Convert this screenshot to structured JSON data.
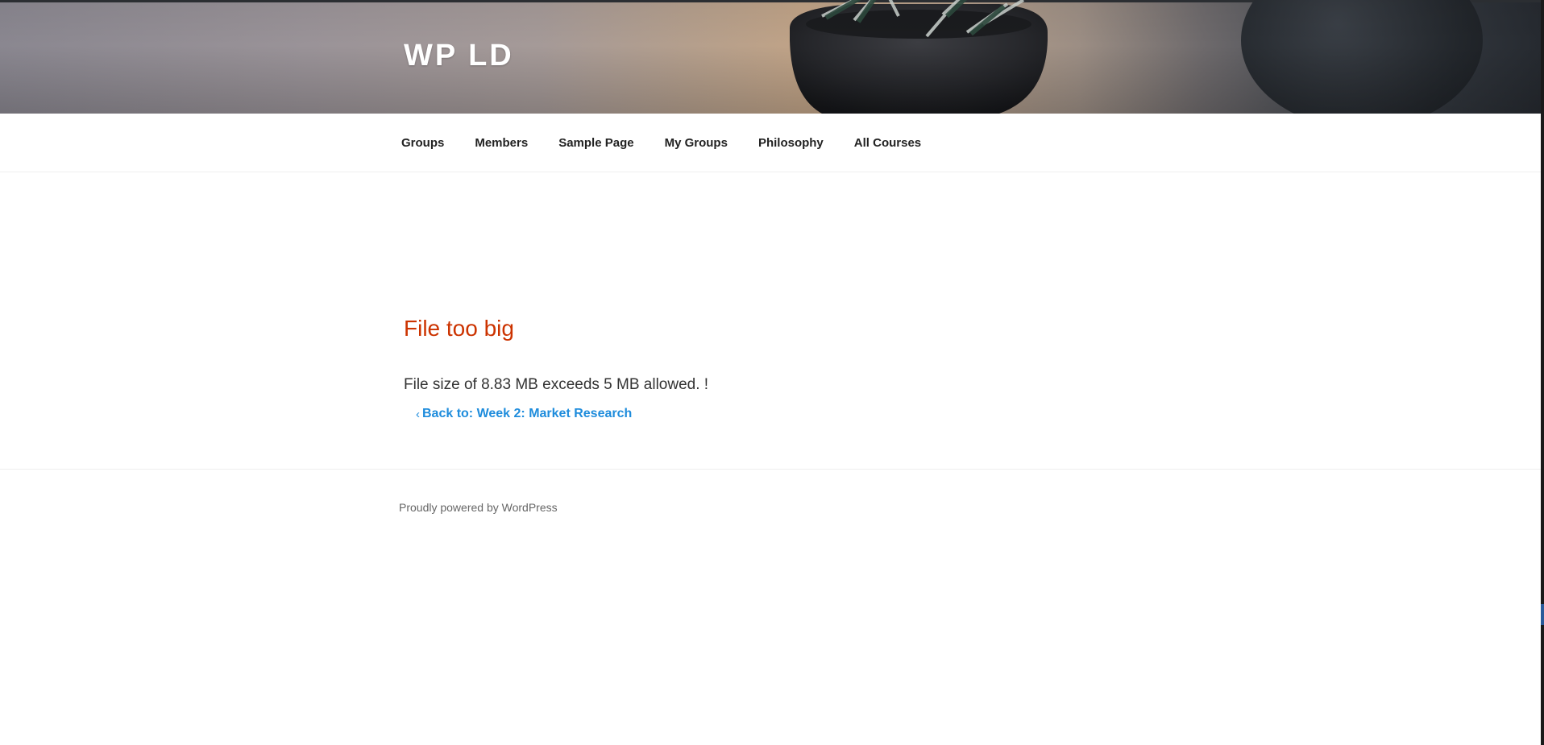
{
  "site": {
    "title": "WP LD"
  },
  "nav": {
    "items": [
      {
        "label": "Groups"
      },
      {
        "label": "Members"
      },
      {
        "label": "Sample Page"
      },
      {
        "label": "My Groups"
      },
      {
        "label": "Philosophy"
      },
      {
        "label": "All Courses"
      }
    ]
  },
  "content": {
    "title": "File too big",
    "message": "File size of 8.83 MB exceeds 5 MB allowed. !",
    "back_chevron": "‹",
    "back_link": "Back to: Week 2: Market Research"
  },
  "footer": {
    "credit": "Proudly powered by WordPress"
  },
  "colors": {
    "title_red": "#cc3300",
    "link_blue": "#1e8cdc"
  }
}
